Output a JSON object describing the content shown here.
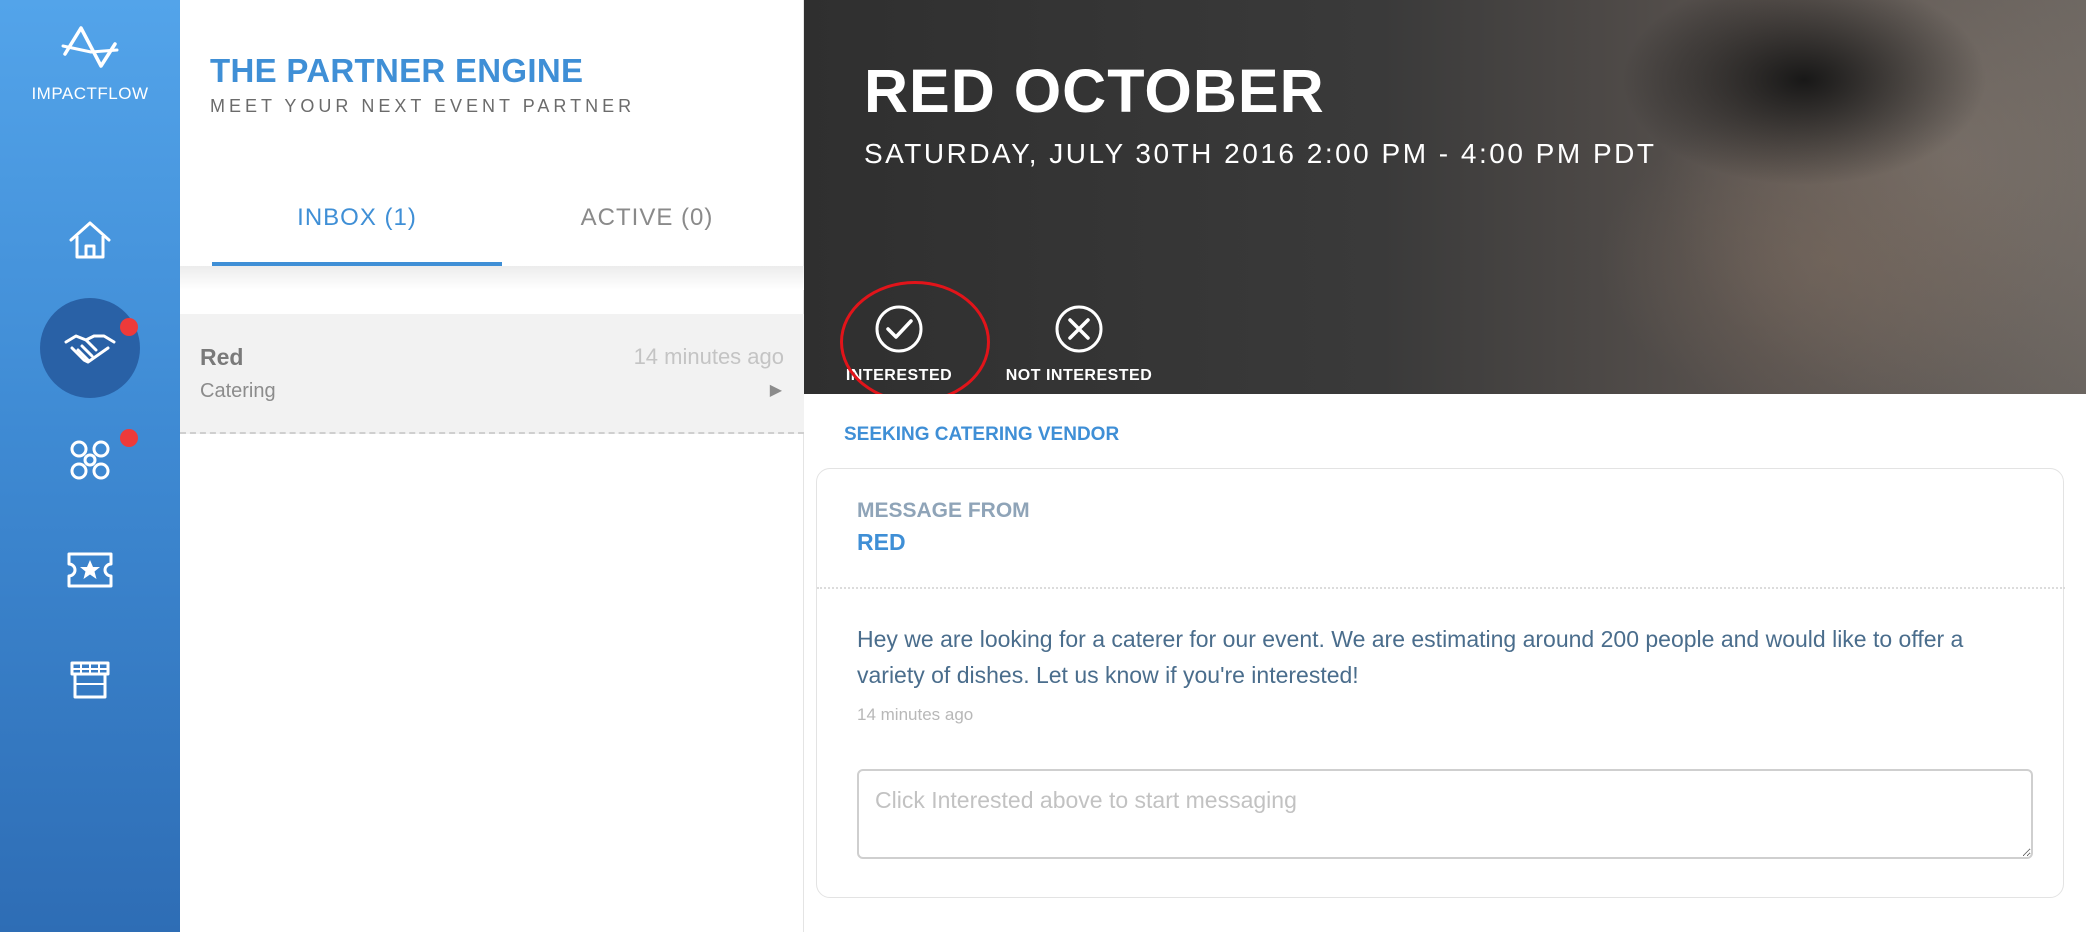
{
  "app": {
    "logo_text": "IMPACTFLOW",
    "accent_color": "#3f8fd6",
    "alert_color": "#ee3a3a"
  },
  "nav": {
    "items": [
      {
        "name": "home",
        "icon": "home-icon",
        "active": false,
        "badge": false
      },
      {
        "name": "partners",
        "icon": "handshake-icon",
        "active": true,
        "badge": true
      },
      {
        "name": "network",
        "icon": "network-icon",
        "active": false,
        "badge": true
      },
      {
        "name": "tickets",
        "icon": "ticket-star-icon",
        "active": false,
        "badge": false
      },
      {
        "name": "vendors",
        "icon": "storefront-icon",
        "active": false,
        "badge": false
      }
    ]
  },
  "panel": {
    "title": "THE PARTNER ENGINE",
    "subtitle": "MEET YOUR NEXT EVENT PARTNER",
    "tabs": [
      {
        "label": "INBOX (1)",
        "selected": true
      },
      {
        "label": "ACTIVE (0)",
        "selected": false
      }
    ],
    "inbox": [
      {
        "name": "Red",
        "category": "Catering",
        "time": "14 minutes ago"
      }
    ]
  },
  "event": {
    "title": "RED OCTOBER",
    "date": "SATURDAY, JULY 30TH 2016 2:00 PM - 4:00 PM PDT",
    "actions": {
      "interested": "INTERESTED",
      "not_interested": "NOT INTERESTED"
    },
    "seeking": "SEEKING CATERING VENDOR",
    "message": {
      "heading": "MESSAGE FROM",
      "sender": "RED",
      "body": "Hey we are looking for a caterer for our event. We are estimating around 200 people and would like to offer a variety of dishes. Let us know if you're interested!",
      "time": "14 minutes ago"
    },
    "reply_placeholder": "Click Interested above to start messaging"
  }
}
